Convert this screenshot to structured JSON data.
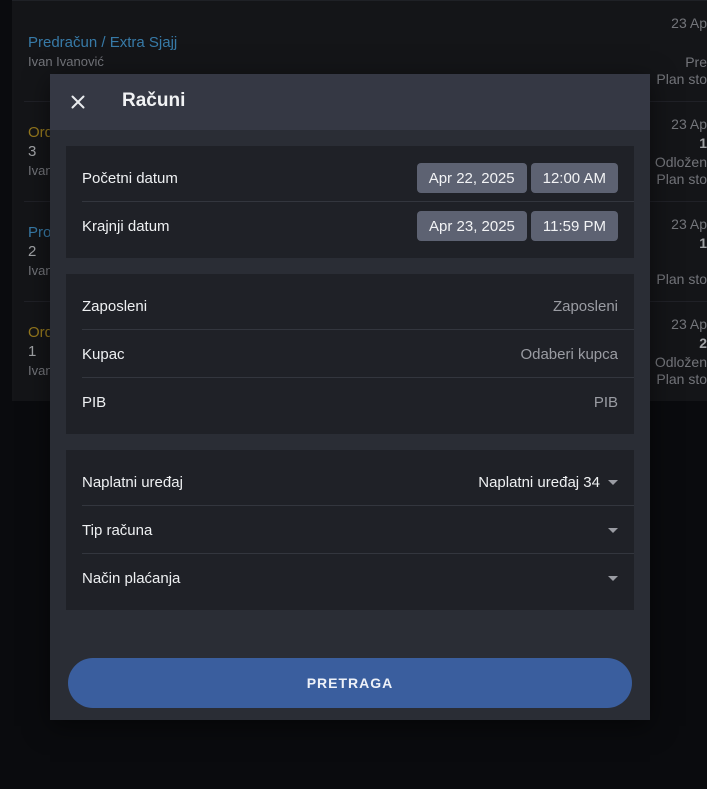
{
  "background_list": [
    {
      "title": "Predračun / Extra Sjajj",
      "title_color": "#4aa3df",
      "number": "",
      "person": "Ivan Ivanović",
      "date": "23 Ap",
      "bold": "",
      "status": "Pre",
      "status2": "Plan sto"
    },
    {
      "title": "Ord",
      "title_color": "#c9a227",
      "number": "3",
      "person": "Ivan",
      "date": "23 Ap",
      "bold": "1",
      "status": "Odložen",
      "status2": "Plan sto"
    },
    {
      "title": "Pro",
      "title_color": "#4aa3df",
      "number": "2",
      "person": "Ivan",
      "date": "23 Ap",
      "bold": "1",
      "status": "",
      "status2": "Plan sto"
    },
    {
      "title": "Ord",
      "title_color": "#c9a227",
      "number": "1",
      "person": "Ivan",
      "date": "23 Ap",
      "bold": "2",
      "status": "Odložen",
      "status2": "Plan sto"
    }
  ],
  "modal": {
    "title": "Računi",
    "close_icon": "close-icon",
    "dates": {
      "start_label": "Početni datum",
      "start_date": "Apr 22, 2025",
      "start_time": "12:00 AM",
      "end_label": "Krajnji datum",
      "end_date": "Apr 23, 2025",
      "end_time": "11:59 PM"
    },
    "filters": {
      "employee_label": "Zaposleni",
      "employee_placeholder": "Zaposleni",
      "customer_label": "Kupac",
      "customer_placeholder": "Odaberi kupca",
      "pib_label": "PIB",
      "pib_placeholder": "PIB"
    },
    "selects": {
      "device_label": "Naplatni uređaj",
      "device_value": "Naplatni uređaj 34",
      "type_label": "Tip računa",
      "type_value": "",
      "payment_label": "Način plaćanja",
      "payment_value": ""
    },
    "search_button": "PRETRAGA",
    "accent_color": "#3a5e9e"
  }
}
